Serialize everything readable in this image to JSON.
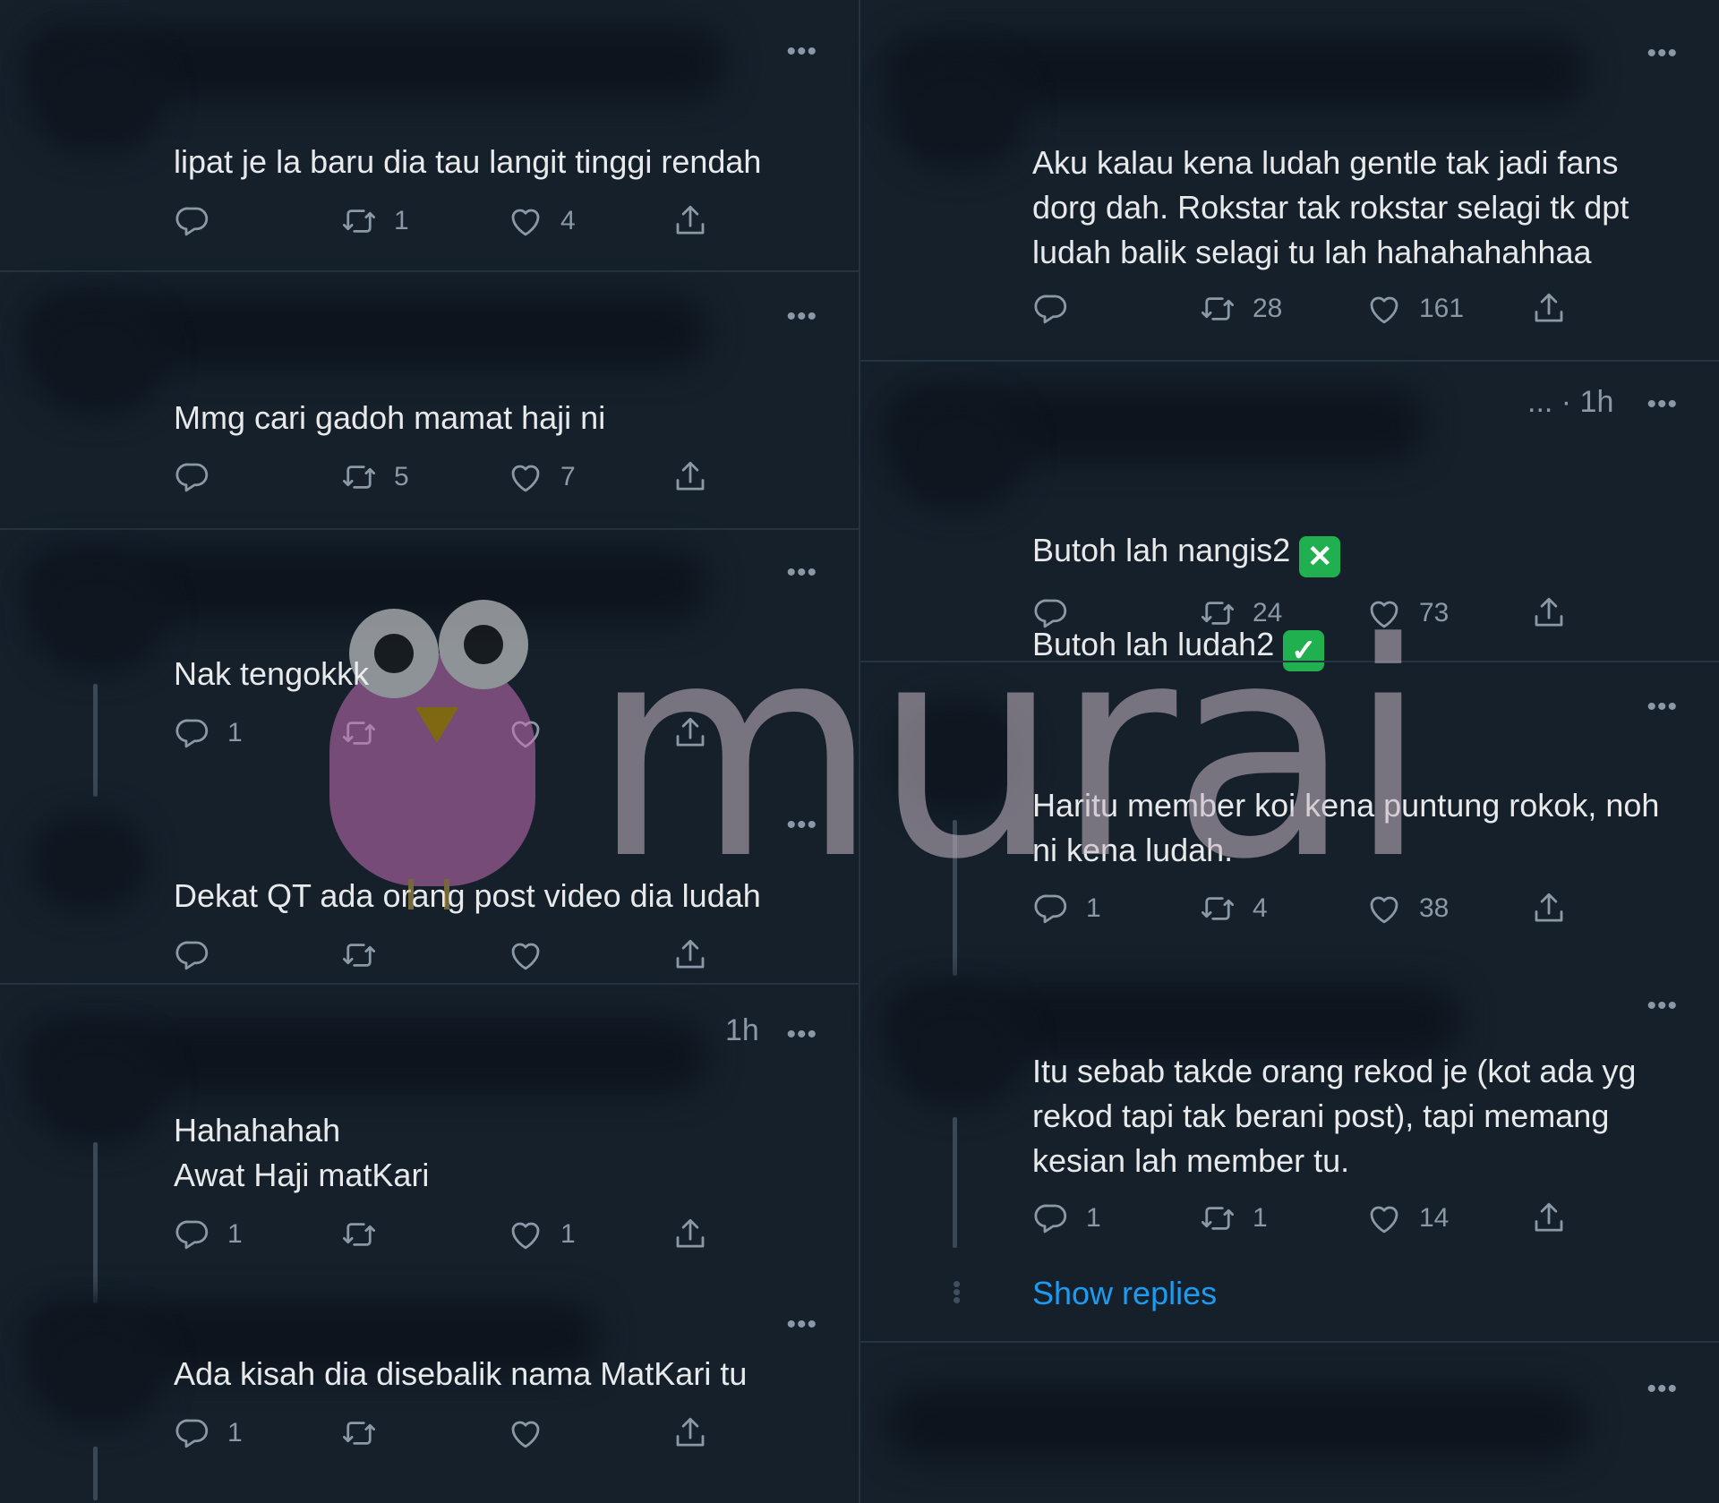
{
  "left_column": [
    {
      "text": "lipat je la baru dia tau langit tinggi rendah",
      "counts": {
        "reply": "",
        "retweet": "1",
        "like": "4"
      }
    },
    {
      "text": "Mmg cari gadoh mamat haji ni",
      "counts": {
        "reply": "",
        "retweet": "5",
        "like": "7"
      }
    },
    {
      "text": "Nak tengokkk",
      "counts": {
        "reply": "1",
        "retweet": "",
        "like": ""
      }
    },
    {
      "text": "Dekat QT ada orang post video dia ludah",
      "counts": {
        "reply": "",
        "retweet": "",
        "like": ""
      }
    },
    {
      "time": "1h",
      "text": "Hahahahah\nAwat Haji matKari",
      "counts": {
        "reply": "1",
        "retweet": "",
        "like": "1"
      }
    },
    {
      "text": "Ada kisah dia disebalik nama MatKari tu",
      "counts": {
        "reply": "1",
        "retweet": "",
        "like": ""
      }
    }
  ],
  "right_column": [
    {
      "text": "Aku kalau kena ludah gentle tak jadi fans dorg dah. Rokstar tak rokstar selagi tk dpt ludah balik selagi tu lah hahahahahhaa",
      "counts": {
        "reply": "",
        "retweet": "28",
        "like": "161"
      }
    },
    {
      "name_tail": "... · 1h",
      "line1": "Butoh lah nangis2",
      "line2": "Butoh lah ludah2",
      "emoji_x": "✕",
      "emoji_check": "✓",
      "counts": {
        "reply": "",
        "retweet": "24",
        "like": "73"
      }
    },
    {
      "text": "Haritu member koi kena puntung rokok, noh ni kena ludah.",
      "counts": {
        "reply": "1",
        "retweet": "4",
        "like": "38"
      }
    },
    {
      "text": "Itu sebab takde orang rekod je (kot ada yg rekod tapi tak berani post), tapi memang kesian lah member tu.",
      "counts": {
        "reply": "1",
        "retweet": "1",
        "like": "14"
      }
    }
  ],
  "show_replies": "Show replies",
  "more_label": "•••",
  "watermark": "murai",
  "colors": {
    "background": "#15202b",
    "text": "#e7e9ea",
    "muted": "#8b98a5",
    "link": "#1d9bf0",
    "divider": "#253341"
  },
  "icons": [
    "reply-icon",
    "retweet-icon",
    "like-icon",
    "share-icon",
    "more-icon"
  ]
}
